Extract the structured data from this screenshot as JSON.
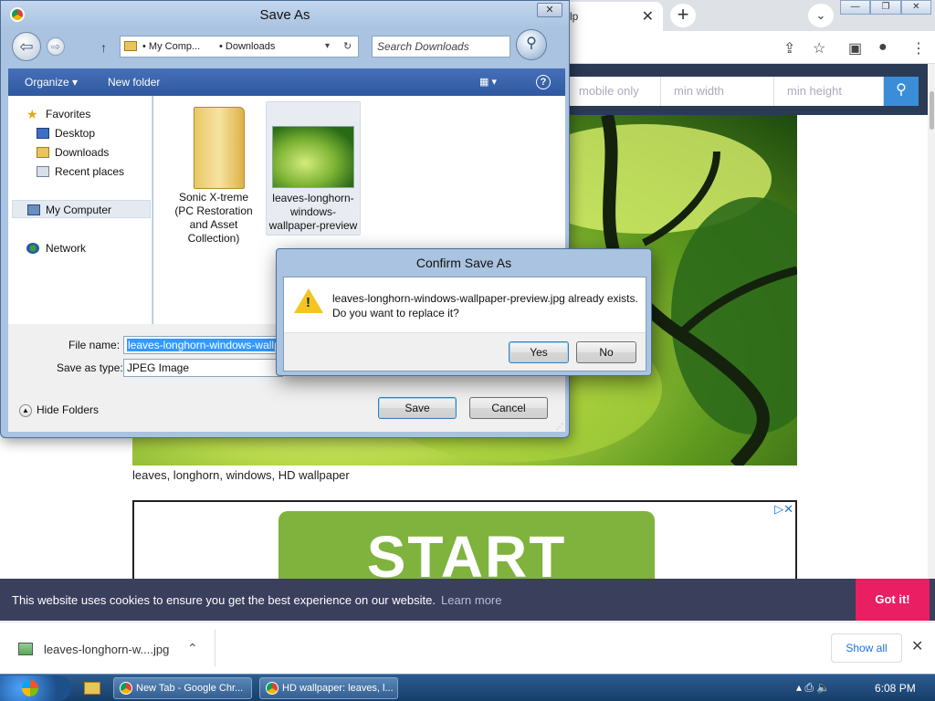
{
  "browser": {
    "tab_title": "lp",
    "new_tab_symbol": "+",
    "tab_close_symbol": "✕",
    "tab_search_symbol": "⌄",
    "window_controls": [
      "—",
      "❐",
      "✕"
    ],
    "toolbar_icons": [
      "share-icon",
      "star-icon",
      "sidebar-icon",
      "profile-icon",
      "menu-icon"
    ],
    "toolbar_glyphs": [
      "⇪",
      "☆",
      "▣",
      "●",
      "⋮"
    ]
  },
  "site": {
    "filters": [
      "mobile only",
      "min width",
      "min height"
    ],
    "search_glyph": "⚲",
    "wallpaper_caption": "leaves, longhorn, windows, HD wallpaper",
    "ad_text": "START",
    "ad_icons": "▷✕",
    "cookie_text": "This website uses cookies to ensure you get the best experience on our website.",
    "cookie_learn_more": "Learn more",
    "cookie_button": "Got it!"
  },
  "downloads": {
    "file_name": "leaves-longhorn-w....jpg",
    "caret": "⌃",
    "show_all": "Show all",
    "close": "✕"
  },
  "taskbar": {
    "tasks": [
      "New Tab - Google Chr...",
      "HD wallpaper: leaves, l..."
    ],
    "tray_icons": "▴ ⎙ 🔈",
    "time": "6:08 PM"
  },
  "save_as": {
    "title": "Save As",
    "close": "✕",
    "nav_back": "⇦",
    "nav_fwd": "⇨",
    "nav_up": "↑",
    "address": [
      "My Comp...",
      "Downloads"
    ],
    "address_sep": "•",
    "address_drop": "▾",
    "address_refresh": "↻",
    "search_placeholder": "Search Downloads",
    "search_glyph": "⚲",
    "organize": "Organize ▾",
    "new_folder": "New folder",
    "view_glyph": "▦ ▾",
    "help_glyph": "?",
    "nav": {
      "favorites": "Favorites",
      "desktop": "Desktop",
      "downloads": "Downloads",
      "recent": "Recent places",
      "computer": "My Computer",
      "network": "Network",
      "star_glyph": "★"
    },
    "files": [
      {
        "label": "Sonic X-treme (PC Restoration and Asset Collection)"
      },
      {
        "label": "leaves-longhorn-windows-wallpaper-preview"
      }
    ],
    "file_name_label": "File name:",
    "file_name_value": "leaves-longhorn-windows-wallpaper-preview",
    "save_as_type_label": "Save as type:",
    "save_as_type_value": "JPEG Image",
    "hide_folders": "Hide Folders",
    "hide_folders_glyph": "▲",
    "save": "Save",
    "cancel": "Cancel",
    "grip": "⋰"
  },
  "confirm": {
    "title": "Confirm Save As",
    "line1": "leaves-longhorn-windows-wallpaper-preview.jpg already exists.",
    "line2": "Do you want to replace it?",
    "warn_mark": "!",
    "yes": "Yes",
    "no": "No"
  }
}
